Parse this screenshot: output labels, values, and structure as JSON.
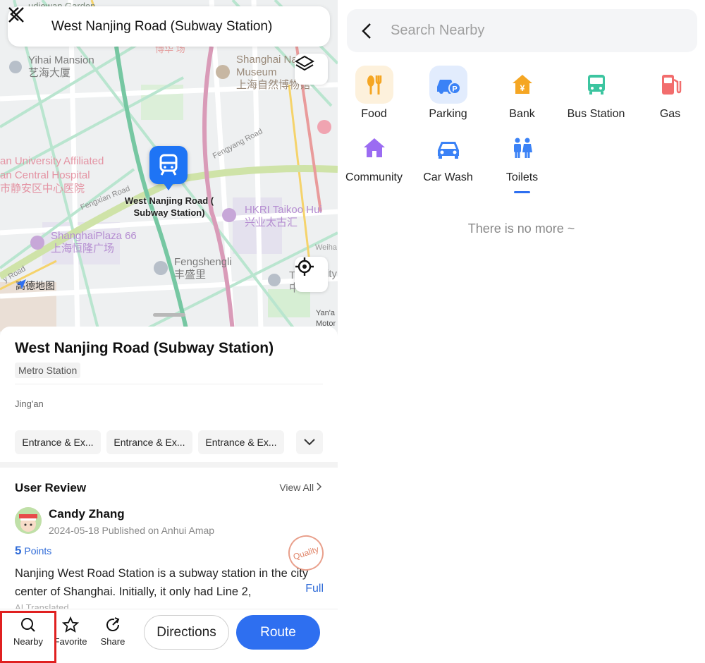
{
  "left_panel": {
    "top_bar": {
      "title": "West Nanjing Road (Subway Station)"
    },
    "map": {
      "station_label": "West Nanjing Road (\nSubway Station)",
      "labels": {
        "yihai_en": "Yihai Mansion",
        "yihai_cn": "艺海大厦",
        "museum_en1": "Shanghai Na",
        "museum_en2": "Museum",
        "museum_cn": "上海自然博物馆",
        "hospital_en1": "an University Affiliated",
        "hospital_en2": "an Central Hospital",
        "hospital_cn": "市静安区中心医院",
        "hkri_en": "HKRI Taikoo Hui",
        "hkri_cn": "兴业太古汇",
        "plaza_en": "ShanghaiPlaza 66",
        "plaza_cn": "上海恒隆广场",
        "fengsheng_en": "Fengshengli",
        "fengsheng_cn": "丰盛里",
        "fengxian_road": "Fengxian Road",
        "fengyang_road": "Fengyang Road",
        "top_cn": "博华 场",
        "corner1": "Yan'a",
        "corner2": "Motor",
        "right_cut1": "T",
        "right_cut2": "ity",
        "right_cut3": "中",
        "weihai": "Weiha",
        "road_bl": "y Road",
        "top_garden": "udiewan Garden"
      },
      "logo": "高德地图"
    },
    "card": {
      "title": "West Nanjing Road (Subway Station)",
      "badge": "Metro Station",
      "district": "Jing'an",
      "chips": [
        "Entrance & Ex...",
        "Entrance & Ex...",
        "Entrance & Ex..."
      ]
    },
    "review": {
      "heading": "User Review",
      "view_all": "View All",
      "user": "Candy Zhang",
      "meta": "2024-05-18 Published on Anhui  Amap",
      "points_value": "5",
      "points_label": " Points",
      "stamp": "Quality",
      "text": "Nanjing West Road Station is a subway station in the city center of Shanghai. Initially, it only had Line 2,",
      "full": "Full",
      "translated": "AI Translated"
    },
    "bottom_bar": {
      "nearby": "Nearby",
      "favorite": "Favorite",
      "share": "Share",
      "directions": "Directions",
      "route": "Route"
    }
  },
  "right_panel": {
    "search": {
      "placeholder": "Search Nearby"
    },
    "categories": [
      {
        "label": "Food",
        "icon": "fork-knife-icon",
        "color": "#f5a623"
      },
      {
        "label": "Parking",
        "icon": "parking-car-icon",
        "color": "#3b82f6"
      },
      {
        "label": "Bank",
        "icon": "bank-yen-icon",
        "color": "#f5a623"
      },
      {
        "label": "Bus Station",
        "icon": "bus-icon",
        "color": "#3cc5a0"
      },
      {
        "label": "Gas",
        "icon": "gas-pump-icon",
        "color": "#f26d6d"
      },
      {
        "label": "Community",
        "icon": "house-icon",
        "color": "#9b6cf2"
      },
      {
        "label": "Car Wash",
        "icon": "car-icon",
        "color": "#3b82f6"
      },
      {
        "label": "Toilets",
        "icon": "toilets-icon",
        "color": "#3b82f6"
      }
    ],
    "selected_category": "Toilets",
    "empty_text": "There is no more ~"
  }
}
